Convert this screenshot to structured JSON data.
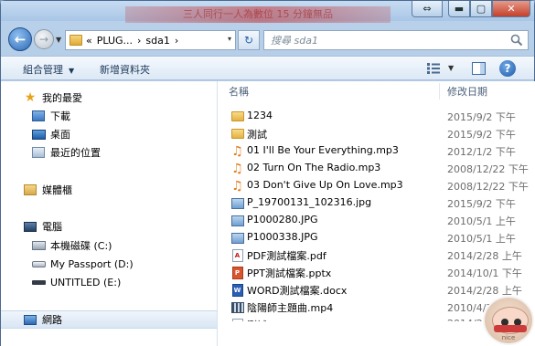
{
  "window": {
    "title": "三人同行一人為數位 15 分鐘無品",
    "buttons": {
      "minimize": "▬",
      "maximize": "▢",
      "close": "✕"
    },
    "extra_button": "⇔"
  },
  "address": {
    "breadcrumbs": [
      "«",
      "PLUG...",
      "›",
      "sda1",
      "›"
    ],
    "dropdown": "▾",
    "refresh": "↻"
  },
  "search": {
    "placeholder": "搜尋 sda1"
  },
  "commands": {
    "organize": "組合管理",
    "organize_arrow": "▼",
    "new_folder": "新增資料夾",
    "view_arrow": "▼",
    "help": "?"
  },
  "nav_pane": {
    "favorites": "我的最愛",
    "favorites_items": [
      "下載",
      "桌面",
      "最近的位置"
    ],
    "libraries": "媒體櫃",
    "computer": "電腦",
    "computer_items": [
      "本機磁碟 (C:)",
      "My Passport (D:)",
      "UNTITLED (E:)"
    ],
    "network": "網路"
  },
  "columns": {
    "name": "名稱",
    "modified": "修改日期"
  },
  "files": [
    {
      "name": "1234",
      "type": "folder",
      "date": "2015/9/2 下午"
    },
    {
      "name": "測試",
      "type": "folder",
      "date": "2015/9/2 下午"
    },
    {
      "name": "01 I'll Be Your Everything.mp3",
      "type": "audio",
      "date": "2012/1/2 下午"
    },
    {
      "name": "02 Turn On The Radio.mp3",
      "type": "audio",
      "date": "2008/12/22 下午"
    },
    {
      "name": "03 Don't Give Up On Love.mp3",
      "type": "audio",
      "date": "2008/12/22 下午"
    },
    {
      "name": "P_19700131_102316.jpg",
      "type": "image",
      "date": "2015/9/2 下午"
    },
    {
      "name": "P1000280.JPG",
      "type": "image",
      "date": "2010/5/1 上午"
    },
    {
      "name": "P1000338.JPG",
      "type": "image",
      "date": "2010/5/1 上午"
    },
    {
      "name": "PDF測試檔案.pdf",
      "type": "pdf",
      "date": "2014/2/28 上午"
    },
    {
      "name": "PPT測試檔案.pptx",
      "type": "ppt",
      "date": "2014/10/1 下午"
    },
    {
      "name": "WORD測試檔案.docx",
      "type": "word",
      "date": "2014/2/28 上午"
    },
    {
      "name": "陰陽師主題曲.mp4",
      "type": "video",
      "date": "2010/4/3 上午"
    },
    {
      "name": "測試XLS.xlsx",
      "type": "doc",
      "date": "2014/2/..."
    }
  ],
  "badge": {
    "text": "nice"
  }
}
